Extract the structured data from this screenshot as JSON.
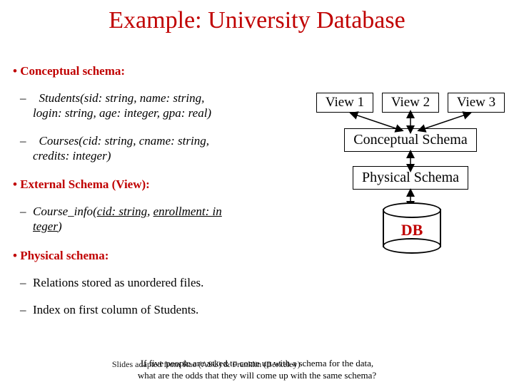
{
  "title": "Example: University Database",
  "sections": {
    "conceptual": {
      "heading": "Conceptual schema:",
      "item1_a": "Students",
      "item1_b": "(sid: string, name: string,",
      "item1_c": "login: string, age: integer, gpa: real)",
      "item2_a": "Courses",
      "item2_b": "(cid: string, cname: string,",
      "item2_c": "credits: integer)"
    },
    "external": {
      "heading": "External Schema (View):",
      "item1_a": "Course_info",
      "item1_b": "(",
      "item1_c": "cid: string",
      "item1_d": ", ",
      "item1_e": "enrollment: in",
      "item1_f": "teger",
      "item1_g": ")"
    },
    "physical": {
      "heading": "Physical schema:",
      "item1": "Relations stored as unordered files.",
      "item2": "Index on first column of Students."
    }
  },
  "diagram": {
    "view1": "View 1",
    "view2": "View 2",
    "view3": "View 3",
    "conceptual": "Conceptual Schema",
    "physical": "Physical Schema",
    "db": "DB"
  },
  "footer": {
    "line1": "If five people are asked to come up with a schema for the data,",
    "line1b": "Slides adapted from Rao (ASU) & Franklin (Berkeley)",
    "line2": "what are the odds that they will come up with the same schema?"
  }
}
